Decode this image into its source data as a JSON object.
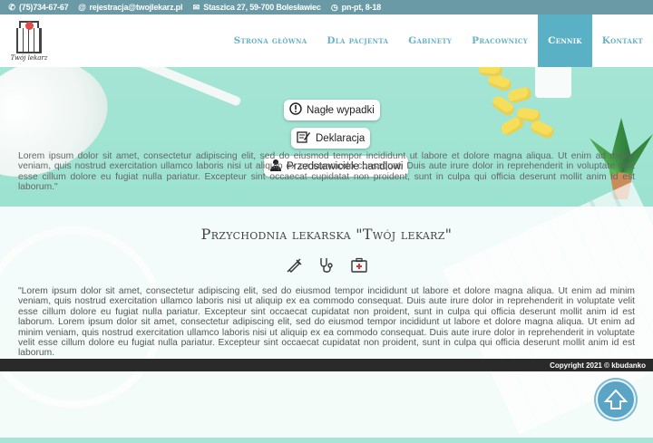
{
  "topbar": {
    "phone": "(75)734-67-67",
    "email": "rejestracja@twojlekarz.pl",
    "address": "Staszica 27, 59-700 Bolesławiec",
    "hours": "pn-pt, 8-18"
  },
  "logo": {
    "text": "Twój lekarz"
  },
  "nav": {
    "items": [
      {
        "label": "Strona główna"
      },
      {
        "label": "Dla pacjenta"
      },
      {
        "label": "Gabinety"
      },
      {
        "label": "Pracownicy"
      },
      {
        "label": "Cennik"
      },
      {
        "label": "Kontakt"
      }
    ],
    "active_index": 4
  },
  "hero": {
    "buttons": [
      {
        "label": "Nagłe wypadki",
        "icon": "exclamation-circle-icon"
      },
      {
        "label": "Deklaracja",
        "icon": "signature-icon"
      },
      {
        "label": "Przedstawiciele handlowi",
        "icon": "user-doctor-icon"
      }
    ]
  },
  "main": {
    "title": "Przychodnia lekarska \"Twój lekarz\"",
    "icons": [
      "syringe-icon",
      "stethoscope-icon",
      "first-aid-kit-icon"
    ],
    "paragraph": "\"Lorem ipsum dolor sit amet, consectetur adipiscing elit, sed do eiusmod tempor incididunt ut labore et dolore magna aliqua. Ut enim ad minim veniam, quis nostrud exercitation ullamco laboris nisi ut aliquip ex ea commodo consequat. Duis aute irure dolor in reprehenderit in voluptate velit esse cillum dolore eu fugiat nulla pariatur. Excepteur sint occaecat cupidatat non proident, sunt in culpa qui officia deserunt mollit anim id est laborum. Lorem ipsum dolor sit amet, consectetur adipiscing elit, sed do eiusmod tempor incididunt ut labore et dolore magna aliqua. Ut enim ad minim veniam, quis nostrud exercitation ullamco laboris nisi ut aliquip ex ea commodo consequat. Duis aute irure dolor in reprehenderit in voluptate velit esse cillum dolore eu fugiat nulla pariatur. Excepteur sint occaecat cupidatat non proident, sunt in culpa qui officia deserunt mollit anim id est laborum.",
    "paragraph_tail": "Lorem ipsum dolor sit amet, consectetur adipiscing elit, sed do eiusmod tempor incididunt ut labore et dolore magna aliqua. Ut enim ad minim veniam, quis nostrud exercitation ullamco laboris nisi ut aliquip ex ea commodo consequat. Duis aute irure dolor in reprehenderit in voluptate velit esse cillum dolore eu fugiat nulla pariatur. Excepteur sint occaecat cupidatat non proident, sunt in culpa qui officia deserunt mollit anim id est laborum.\""
  },
  "footer": {
    "copyright": "Copyright 2021 © kbudanko"
  },
  "colors": {
    "accent": "#5ab0c4",
    "topbar": "#6a9aa6",
    "footer": "#2a2a2a"
  }
}
